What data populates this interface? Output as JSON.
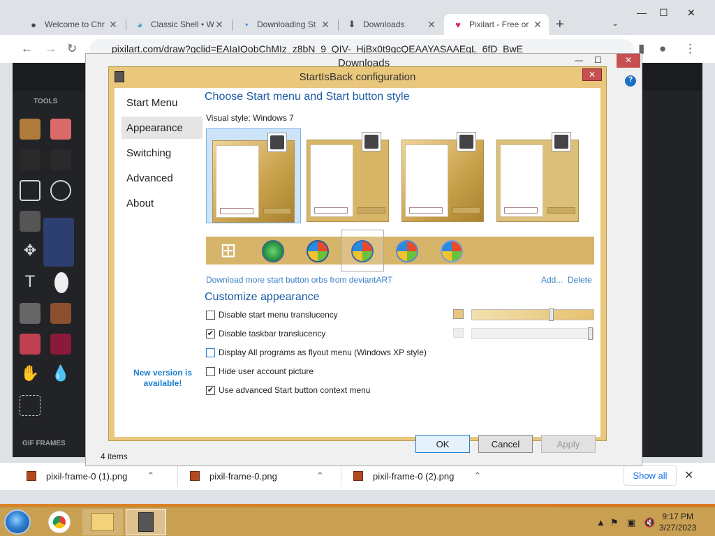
{
  "chrome": {
    "tabs": [
      {
        "title": "Welcome to Chr",
        "icon": "github-icon"
      },
      {
        "title": "Classic Shell • W",
        "icon": "shell-icon"
      },
      {
        "title": "Downloading St",
        "icon": "loading-icon"
      },
      {
        "title": "Downloads",
        "icon": "download-icon"
      },
      {
        "title": "Pixilart - Free or",
        "icon": "heart-icon"
      }
    ],
    "address": "pixilart.com/draw?gclid=EAIaIQobChMIz_z8bN_9_QIV-_HjBx0t9gcQEAAYASAAEgL_6fD_BwE"
  },
  "pixilart": {
    "tools_label": "TOOLS",
    "gif_frames_label": "GIF FRAMES"
  },
  "downloads_bar": {
    "items": [
      "pixil-frame-0 (1).png",
      "pixil-frame-0.png",
      "pixil-frame-0 (2).png"
    ],
    "show_all": "Show all"
  },
  "explorer": {
    "title": "Downloads",
    "status": "4 items"
  },
  "sib": {
    "title": "StartIsBack configuration",
    "nav": [
      "Start Menu",
      "Appearance",
      "Switching",
      "Advanced",
      "About"
    ],
    "selected_nav": "Appearance",
    "new_version": "New version is available!",
    "heading_style": "Choose Start menu and Start button style",
    "visual_style_label": "Visual style:",
    "visual_style_value": "Windows 7",
    "download_orbs": "Download more start button orbs from deviantART",
    "add": "Add...",
    "delete": "Delete",
    "heading_customize": "Customize appearance",
    "options": [
      {
        "label": "Disable start menu translucency",
        "checked": false
      },
      {
        "label": "Disable taskbar translucency",
        "checked": true
      },
      {
        "label": "Display All programs as flyout menu (Windows XP style)",
        "checked": false
      },
      {
        "label": "Hide user account picture",
        "checked": false
      },
      {
        "label": "Use advanced Start button context menu",
        "checked": true
      }
    ],
    "buttons": {
      "ok": "OK",
      "cancel": "Cancel",
      "apply": "Apply"
    },
    "colors": {
      "accent": "#e9c77d",
      "link": "#3a80c9",
      "heading": "#1a5aa3"
    }
  },
  "taskbar": {
    "time": "9:17 PM",
    "date": "3/27/2023"
  }
}
